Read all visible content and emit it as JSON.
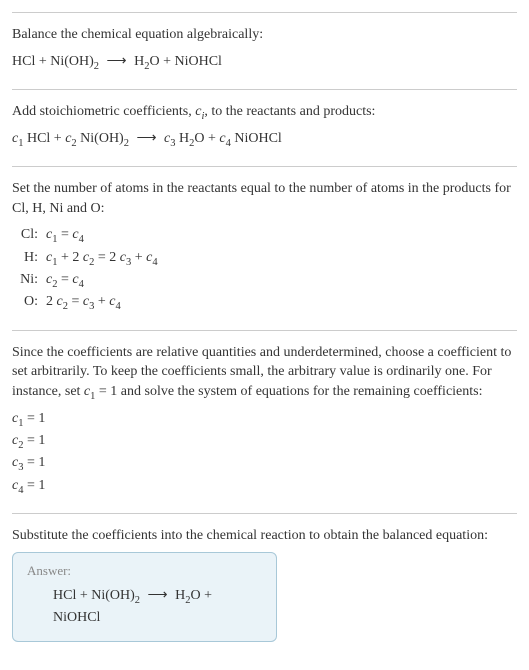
{
  "s1": {
    "line1": "Balance the chemical equation algebraically:",
    "eq_lhs1": "HCl + Ni(OH)",
    "eq_lhs1_sub": "2",
    "arrow": "⟶",
    "eq_rhs1a": "H",
    "eq_rhs1a_sub": "2",
    "eq_rhs1b": "O + NiOHCl"
  },
  "s2": {
    "line1a": "Add stoichiometric coefficients, ",
    "ci": "c",
    "ci_sub": "i",
    "line1b": ", to the reactants and products:",
    "c1": "c",
    "c1_sub": "1",
    "sp1": " HCl + ",
    "c2": "c",
    "c2_sub": "2",
    "sp2": " Ni(OH)",
    "sp2_sub": "2",
    "arrow": "⟶",
    "c3": "c",
    "c3_sub": "3",
    "sp3": " H",
    "sp3_sub": "2",
    "sp3b": "O + ",
    "c4": "c",
    "c4_sub": "4",
    "sp4": " NiOHCl"
  },
  "s3": {
    "line1": "Set the number of atoms in the reactants equal to the number of atoms in the products for Cl, H, Ni and O:",
    "rows": [
      {
        "label": "Cl:",
        "eq": "c₁ = c₄"
      },
      {
        "label": "H:",
        "eq": "c₁ + 2 c₂ = 2 c₃ + c₄"
      },
      {
        "label": "Ni:",
        "eq": "c₂ = c₄"
      },
      {
        "label": "O:",
        "eq": "2 c₂ = c₃ + c₄"
      }
    ],
    "r0_c": "c",
    "r0_s1": "1",
    "r0_eq": " = ",
    "r0_c2": "c",
    "r0_s2": "4",
    "r1_c": "c",
    "r1_s1": "1",
    "r1_p": " + 2 ",
    "r1_c2": "c",
    "r1_s2": "2",
    "r1_eq": " = 2 ",
    "r1_c3": "c",
    "r1_s3": "3",
    "r1_p2": " + ",
    "r1_c4": "c",
    "r1_s4": "4",
    "r2_c": "c",
    "r2_s1": "2",
    "r2_eq": " = ",
    "r2_c2": "c",
    "r2_s2": "4",
    "r3_p0": "2 ",
    "r3_c": "c",
    "r3_s1": "2",
    "r3_eq": " = ",
    "r3_c2": "c",
    "r3_s2": "3",
    "r3_p": " + ",
    "r3_c3": "c",
    "r3_s3": "4"
  },
  "s4": {
    "line1a": "Since the coefficients are relative quantities and underdetermined, choose a coefficient to set arbitrarily. To keep the coefficients small, the arbitrary value is ordinarily one. For instance, set ",
    "c1": "c",
    "c1_sub": "1",
    "line1b": " = 1 and solve the system of equations for the remaining coefficients:",
    "l1_c": "c",
    "l1_s": "1",
    "l1_v": " = 1",
    "l2_c": "c",
    "l2_s": "2",
    "l2_v": " = 1",
    "l3_c": "c",
    "l3_s": "3",
    "l3_v": " = 1",
    "l4_c": "c",
    "l4_s": "4",
    "l4_v": " = 1"
  },
  "s5": {
    "line1": "Substitute the coefficients into the chemical reaction to obtain the balanced equation:",
    "answer_label": "Answer:",
    "lhs1": "HCl + Ni(OH)",
    "lhs1_sub": "2",
    "arrow": "⟶",
    "rhs1": "H",
    "rhs1_sub": "2",
    "rhs2": "O + NiOHCl"
  }
}
